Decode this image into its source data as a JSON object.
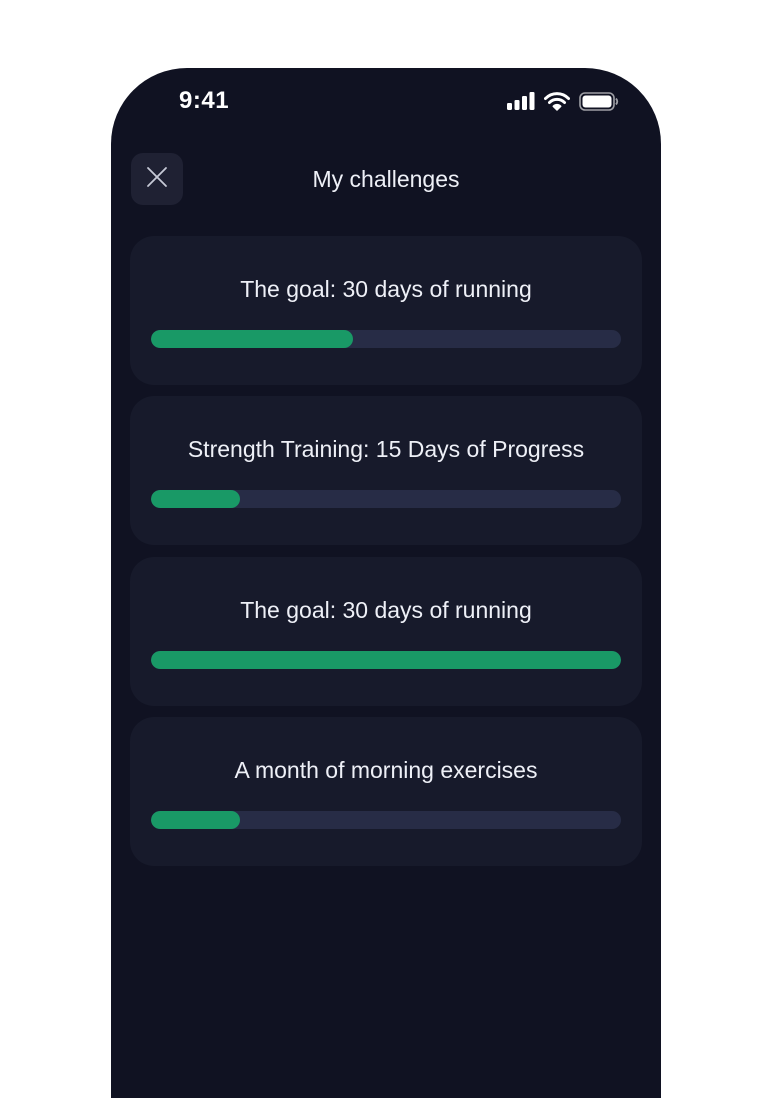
{
  "status_bar": {
    "time": "9:41",
    "icons": [
      "cellular-signal-icon",
      "wifi-icon",
      "battery-icon"
    ]
  },
  "header": {
    "title": "My challenges",
    "close_icon": "close-icon"
  },
  "challenges": [
    {
      "title": "The goal: 30 days of running",
      "progress": 0.43
    },
    {
      "title": "Strength Training: 15 Days of Progress",
      "progress": 0.19
    },
    {
      "title": "The goal: 30 days of running",
      "progress": 1.0
    },
    {
      "title": "A month of morning exercises",
      "progress": 0.19
    }
  ],
  "colors": {
    "background": "#101222",
    "card": "#171a2b",
    "track": "#272c46",
    "fill": "#199966",
    "text": "#eef0f7"
  }
}
